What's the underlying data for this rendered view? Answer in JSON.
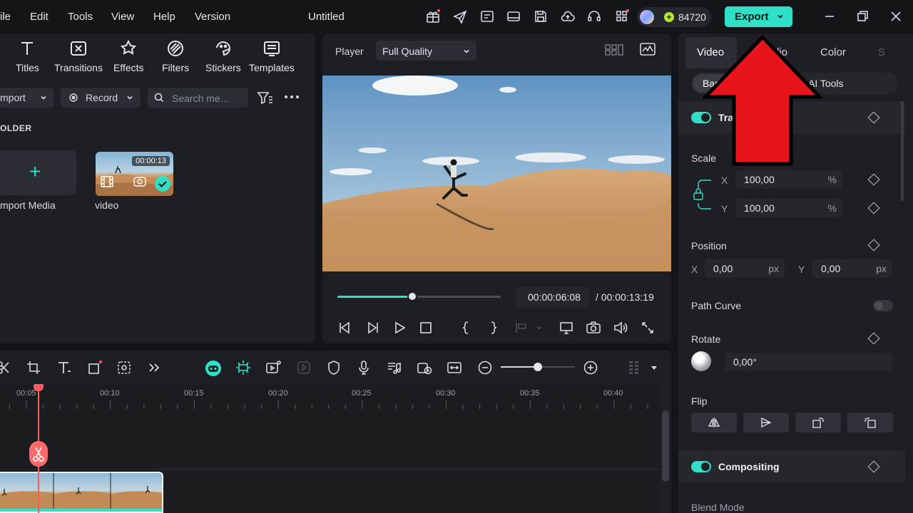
{
  "menu": {
    "items": [
      "ile",
      "Edit",
      "Tools",
      "View",
      "Help",
      "Version"
    ],
    "title": "Untitled",
    "credits": "84720",
    "export_label": "Export"
  },
  "media": {
    "tools": [
      "Titles",
      "Transitions",
      "Effects",
      "Filters",
      "Stickers",
      "Templates"
    ],
    "import_label": "mport",
    "record_label": "Record",
    "search_placeholder": "Search me...",
    "folder_label": "OLDER",
    "import_media_label": "mport Media",
    "clip_duration": "00:00:13",
    "clip_label": "video"
  },
  "player": {
    "label": "Player",
    "quality": "Full Quality",
    "current_time": "00:00:06:08",
    "total_time": "/ 00:00:13:19",
    "progress": 0.46
  },
  "props": {
    "tabs": [
      "Video",
      "dio",
      "Color",
      "S"
    ],
    "subtabs": [
      "Basi",
      "AI Tools"
    ],
    "transform_title": "Tra",
    "scale_label": "Scale",
    "scale_x": "100,00",
    "scale_y": "100,00",
    "percent_unit": "%",
    "position_label": "Position",
    "pos_x": "0,00",
    "pos_y": "0,00",
    "px_unit": "px",
    "path_curve_label": "Path Curve",
    "rotate_label": "Rotate",
    "rotate_value": "0,00°",
    "flip_label": "Flip",
    "compositing_title": "Compositing",
    "blend_mode_label": "Blend Mode",
    "axis_x": "X",
    "axis_y": "Y"
  },
  "timeline": {
    "ticks": [
      "00:05",
      "00:10",
      "00:15",
      "00:20",
      "00:25",
      "00:30",
      "00:35",
      "00:40"
    ],
    "zoom": 0.5
  },
  "colors": {
    "accent": "#2fe0c7",
    "playhead": "#ff5a5f",
    "arrow": "#e8141c"
  }
}
